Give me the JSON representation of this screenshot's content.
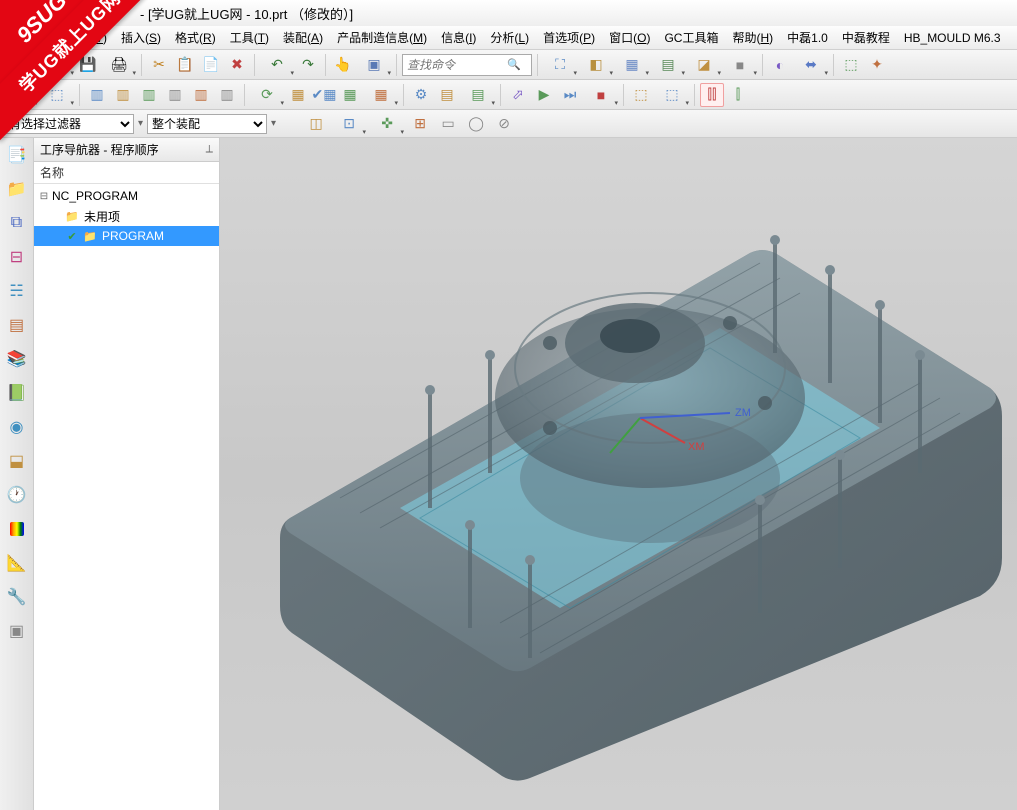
{
  "watermark": {
    "top": "9SUG",
    "ribbon": "学UG就上UG网"
  },
  "title": " - [学UG就上UG网 - 10.prt （修改的）]",
  "menus": [
    "视图(V)",
    "插入(S)",
    "格式(R)",
    "工具(T)",
    "装配(A)",
    "产品制造信息(M)",
    "信息(I)",
    "分析(L)",
    "首选项(P)",
    "窗口(O)",
    "GC工具箱",
    "帮助(H)",
    "中磊1.0",
    "中磊教程",
    "HB_MOULD M6.3"
  ],
  "search": {
    "placeholder": "查找命令"
  },
  "filterbar": {
    "filter_label": "有选择过滤器",
    "assembly": "整个装配"
  },
  "navigator": {
    "title": "工序导航器 - 程序顺序",
    "column": "名称",
    "tree": {
      "root": "NC_PROGRAM",
      "items": [
        {
          "label": "未用项",
          "icon": "folder",
          "selected": false
        },
        {
          "label": "PROGRAM",
          "icon": "folder-check",
          "selected": true
        }
      ]
    }
  },
  "viewport": {
    "axis_labels": {
      "x": "XM",
      "z": "ZM"
    }
  },
  "toolbar_icons_row1": [
    "new",
    "open",
    "save",
    "print",
    "|",
    "cut",
    "copy",
    "paste",
    "delete",
    "|",
    "undo",
    "redo",
    "|",
    "touch",
    "cmd",
    "|",
    "search",
    "|",
    "fit",
    "cube",
    "box",
    "layer",
    "wcs",
    "color",
    "|",
    "render",
    "move",
    "|",
    "asm",
    "explode"
  ],
  "toolbar_icons_row2": [
    "prog",
    "geom",
    "tool",
    "method",
    "|",
    "op1",
    "op2",
    "op3",
    "op4",
    "op5",
    "op6",
    "|",
    "gen",
    "verify",
    "list",
    "sim",
    "post",
    "|",
    "mach",
    "nc",
    "shop",
    "|",
    "path",
    "play",
    "step",
    "stop",
    "|",
    "opt",
    "more",
    "|",
    "m1",
    "m2"
  ],
  "leftbar_icons": [
    "nav",
    "part",
    "asm",
    "cons",
    "feat",
    "layer",
    "reuse",
    "role",
    "hd3d",
    "history",
    "browser",
    "tool",
    "sketch",
    "render"
  ]
}
